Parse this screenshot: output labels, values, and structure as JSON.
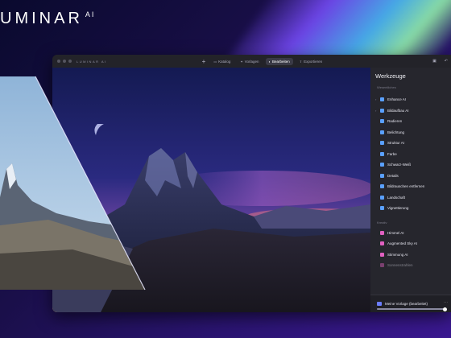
{
  "brand": {
    "name": "UMINAR",
    "suffix": "AI"
  },
  "app": {
    "title": "LUMINAR AI",
    "tabs": [
      {
        "label": "Katalog",
        "icon": "catalog-icon",
        "active": false
      },
      {
        "label": "Vorlagen",
        "icon": "templates-icon",
        "active": false
      },
      {
        "label": "Bearbeiten",
        "icon": "edit-icon",
        "active": true
      },
      {
        "label": "Exportieren",
        "icon": "export-icon",
        "active": false
      }
    ]
  },
  "panel": {
    "title": "Werkzeuge",
    "section_essentials": "Wesentliches",
    "tools": [
      {
        "label": "Enhance AI",
        "icon_color": "#5aa0ff",
        "has_chevron": true
      },
      {
        "label": "Bildaufbau AI",
        "icon_color": "#5aa0ff",
        "has_chevron": true
      },
      {
        "label": "Radieren",
        "icon_color": "#5aa0ff",
        "has_chevron": false
      },
      {
        "label": "Belichtung",
        "icon_color": "#5aa0ff",
        "has_chevron": false
      },
      {
        "label": "Struktur AI",
        "icon_color": "#5aa0ff",
        "has_chevron": false
      },
      {
        "label": "Farbe",
        "icon_color": "#5aa0ff",
        "has_chevron": false
      },
      {
        "label": "Schwarz-Weiß",
        "icon_color": "#5aa0ff",
        "has_chevron": false
      },
      {
        "label": "Details",
        "icon_color": "#5aa0ff",
        "has_chevron": false
      },
      {
        "label": "Bildrauschen entfernen",
        "icon_color": "#5aa0ff",
        "has_chevron": false
      },
      {
        "label": "Landschaft",
        "icon_color": "#5aa0ff",
        "has_chevron": false
      },
      {
        "label": "Vignettierung",
        "icon_color": "#5aa0ff",
        "has_chevron": false
      }
    ],
    "section_creative": "Kreativ",
    "creative_tools": [
      {
        "label": "Himmel AI",
        "icon_color": "#e060c0"
      },
      {
        "label": "Augmented Sky AI",
        "icon_color": "#e060c0"
      },
      {
        "label": "Stimmung AI",
        "icon_color": "#e060c0"
      },
      {
        "label": "Sonnenstrahlen",
        "icon_color": "#e060c0"
      }
    ],
    "preset": {
      "label": "Meine Vorlage (bearbeitet)",
      "slider_value": 1.0
    }
  },
  "colors": {
    "accent": "#7a4dff",
    "panel_bg": "#26262d"
  }
}
